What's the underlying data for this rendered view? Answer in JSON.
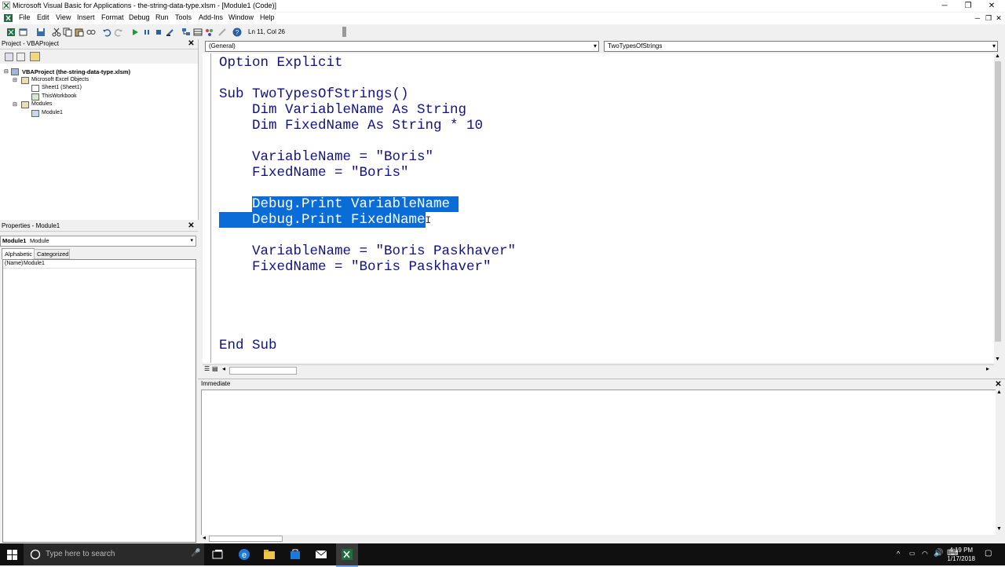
{
  "window": {
    "title": "Microsoft Visual Basic for Applications - the-string-data-type.xlsm - [Module1 (Code)]",
    "min": "─",
    "restore": "❐",
    "close": "✕"
  },
  "menu": {
    "items": [
      "File",
      "Edit",
      "View",
      "Insert",
      "Format",
      "Debug",
      "Run",
      "Tools",
      "Add-Ins",
      "Window",
      "Help"
    ]
  },
  "toolbar": {
    "position": "Ln 11, Col 26"
  },
  "project": {
    "title": "Project - VBAProject",
    "root": "VBAProject (the-string-data-type.xlsm)",
    "folder1": "Microsoft Excel Objects",
    "sheet": "Sheet1 (Sheet1)",
    "workbook": "ThisWorkbook",
    "folder2": "Modules",
    "module": "Module1"
  },
  "properties": {
    "title": "Properties - Module1",
    "object_name": "Module1",
    "object_type": "Module",
    "tab_alpha": "Alphabetic",
    "tab_cat": "Categorized",
    "row_key": "(Name)",
    "row_value": "Module1"
  },
  "code": {
    "object_combo": "(General)",
    "proc_combo": "TwoTypesOfStrings",
    "lines": {
      "l1": "Option Explicit",
      "l3": "Sub TwoTypesOfStrings()",
      "l4": "    Dim VariableName As String",
      "l5": "    Dim FixedName As String * 10",
      "l7": "    VariableName = \"Boris\"",
      "l8": "    FixedName = \"Boris\"",
      "l10a": "    ",
      "l10b": "Debug.Print VariableName ",
      "l11": "    Debug.Print FixedName",
      "l13": "    VariableName = \"Boris Paskhaver\"",
      "l14": "    FixedName = \"Boris Paskhaver\"",
      "l18": "End Sub"
    }
  },
  "immediate": {
    "title": "Immediate"
  },
  "taskbar": {
    "search_placeholder": "Type here to search",
    "time": "4:19 PM",
    "date": "1/17/2018"
  },
  "colors": {
    "selection": "#0a6cd6",
    "code_text": "#10108a"
  }
}
